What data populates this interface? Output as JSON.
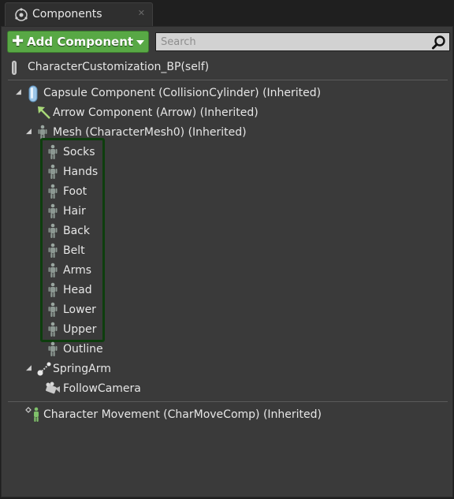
{
  "tab": {
    "title": "Components"
  },
  "toolbar": {
    "add_component_label": "Add Component",
    "search_placeholder": "Search"
  },
  "self": {
    "label": "CharacterCustomization_BP(self)"
  },
  "tree": {
    "capsule": "Capsule Component (CollisionCylinder) (Inherited)",
    "arrow": "Arrow Component (Arrow) (Inherited)",
    "mesh": "Mesh (CharacterMesh0) (Inherited)",
    "mesh_children": [
      "Socks",
      "Hands",
      "Foot",
      "Hair",
      "Back",
      "Belt",
      "Arms",
      "Head",
      "Lower",
      "Upper"
    ],
    "outline": "Outline",
    "spring_arm": "SpringArm",
    "camera": "FollowCamera"
  },
  "movement": {
    "label": "Character Movement (CharMoveComp) (Inherited)"
  },
  "colors": {
    "add_button": "#58a845",
    "highlight_border": "#0d3e0d",
    "panel_bg": "#3a3a3a"
  },
  "icons": [
    "components-icon",
    "close-icon",
    "plus-icon",
    "dropdown-icon",
    "search-icon",
    "pawn-icon",
    "capsule-icon",
    "arrow-icon",
    "skeletal-mesh-icon",
    "spring-arm-icon",
    "camera-icon",
    "movement-icon"
  ]
}
